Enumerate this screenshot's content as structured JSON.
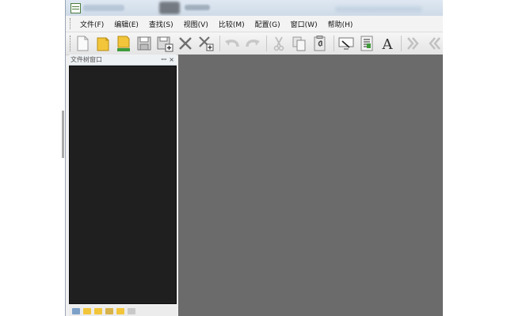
{
  "window": {
    "title": "",
    "title_bar_style": "blurred"
  },
  "menubar": {
    "items": [
      {
        "label": "文件(F)"
      },
      {
        "label": "编辑(E)"
      },
      {
        "label": "查找(S)"
      },
      {
        "label": "视图(V)"
      },
      {
        "label": "比较(M)"
      },
      {
        "label": "配置(G)"
      },
      {
        "label": "窗口(W)"
      },
      {
        "label": "帮助(H)"
      }
    ]
  },
  "toolbar": {
    "buttons": [
      {
        "icon": "new-file-icon"
      },
      {
        "icon": "open-folder-icon"
      },
      {
        "icon": "open-folder-green-icon"
      },
      {
        "icon": "save-icon"
      },
      {
        "icon": "save-all-icon"
      },
      {
        "icon": "close-icon"
      },
      {
        "icon": "close-all-icon"
      },
      {
        "icon": "undo-icon"
      },
      {
        "icon": "redo-icon"
      },
      {
        "icon": "cut-icon"
      },
      {
        "icon": "copy-icon"
      },
      {
        "icon": "paste-icon"
      },
      {
        "icon": "monitor-icon"
      },
      {
        "icon": "list-icon"
      },
      {
        "icon": "font-icon"
      },
      {
        "icon": "indent-icon"
      },
      {
        "icon": "outdent-icon"
      },
      {
        "icon": "more-icon"
      }
    ],
    "font_glyph": "A"
  },
  "side_panel": {
    "title": "文件树窗口",
    "pin_glyph": "ꟷ",
    "close_glyph": "×"
  },
  "colors": {
    "panel_background": "#1f1f1f",
    "editor_background": "#6b6b6b",
    "folder_yellow": "#f2c53a"
  }
}
